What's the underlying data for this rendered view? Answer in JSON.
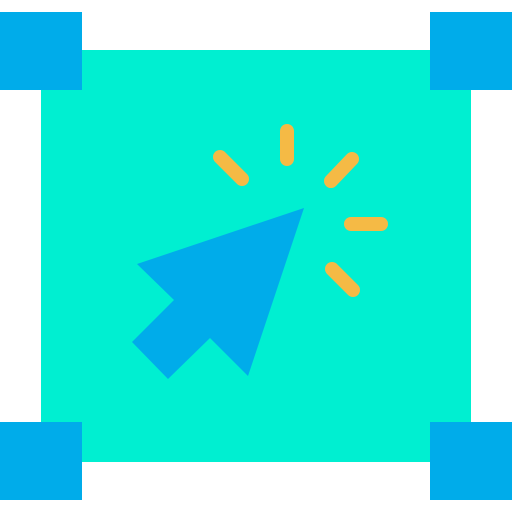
{
  "icon": {
    "name": "click-select-icon",
    "colors": {
      "fill": "#00EFD1",
      "handles": "#00ACEA",
      "cursor": "#00ACEA",
      "sparks": "#F5BA45"
    },
    "parts": [
      "selection-area",
      "corner-handle-top-left",
      "corner-handle-top-right",
      "corner-handle-bottom-left",
      "corner-handle-bottom-right",
      "cursor-arrow-icon",
      "click-spark-lines"
    ]
  }
}
